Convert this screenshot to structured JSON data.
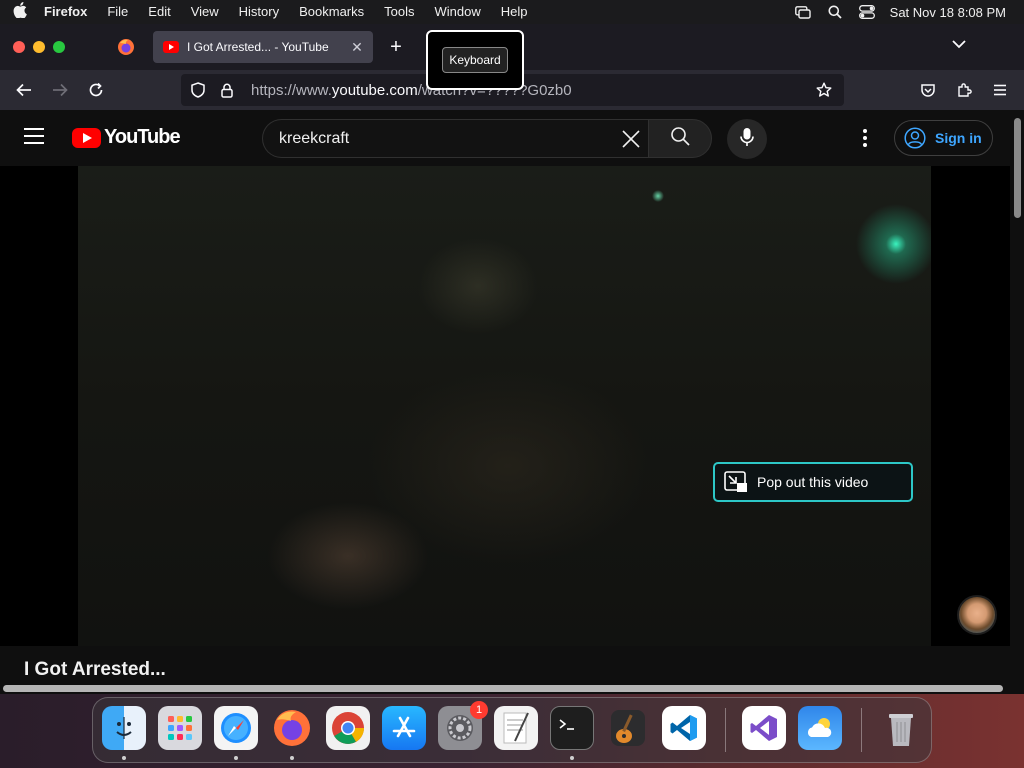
{
  "menubar": {
    "app_name": "Firefox",
    "menus": [
      "File",
      "Edit",
      "View",
      "History",
      "Bookmarks",
      "Tools",
      "Window",
      "Help"
    ],
    "clock": "Sat Nov 18  8:08 PM"
  },
  "browser": {
    "tab_title": "I Got Arrested... - YouTube",
    "url_prefix": "https://www.",
    "url_host": "youtube.com",
    "url_path": "/watch?v=?????G0zb0",
    "tooltip": "Keyboard"
  },
  "youtube": {
    "logo_text": "YouTube",
    "search_value": "kreekcraft",
    "signin_label": "Sign in",
    "popout_label": "Pop out this video",
    "video_title": "I Got Arrested..."
  },
  "dock": {
    "apps": [
      "Finder",
      "Launchpad",
      "Safari",
      "Firefox",
      "Chrome",
      "App Store",
      "System Settings",
      "TextEdit",
      "Terminal",
      "GarageBand",
      "Visual Studio Code",
      "Visual Studio",
      "Weather",
      "Trash"
    ],
    "settings_badge": "1"
  },
  "colors": {
    "accent_link": "#3ea6ff",
    "youtube_red": "#ff0000",
    "popout_border": "#2dc7c7"
  }
}
